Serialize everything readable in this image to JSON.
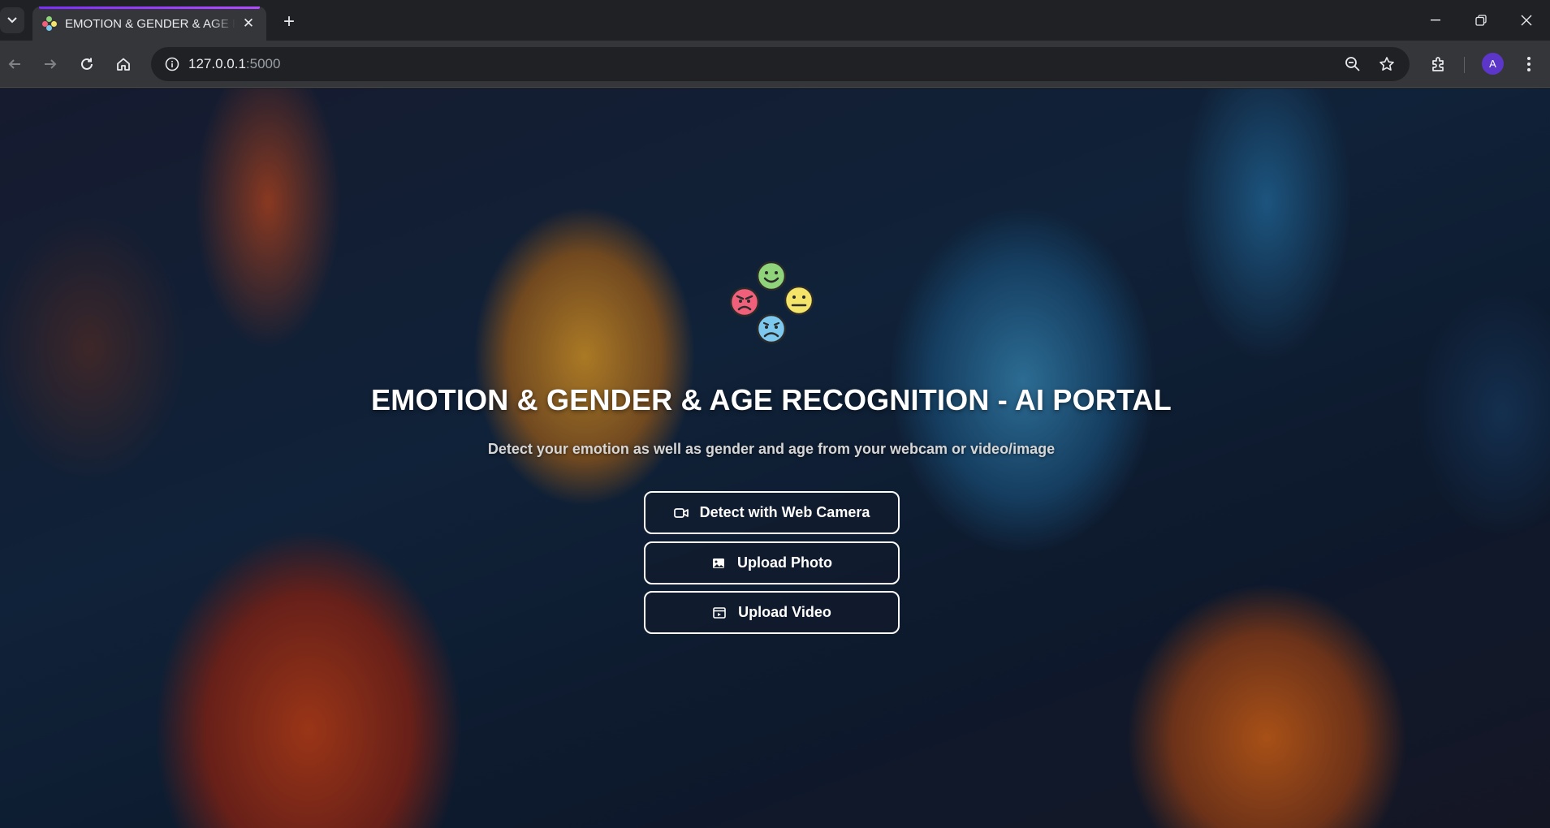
{
  "browser": {
    "tab_title": "EMOTION & GENDER & AGE RECOGNITION - AI PORTAL",
    "url_host": "127.0.0.1",
    "url_port": ":5000",
    "profile_initial": "A"
  },
  "hero": {
    "title": "EMOTION & GENDER & AGE RECOGNITION - AI PORTAL",
    "subtitle": "Detect your emotion as well as gender and age from your webcam or video/image"
  },
  "actions": {
    "webcam_label": "Detect with Web Camera",
    "photo_label": "Upload Photo",
    "video_label": "Upload Video"
  },
  "icons": {
    "webcam": "video-camera-icon",
    "photo": "image-icon",
    "video": "video-file-icon"
  },
  "colors": {
    "button_border": "#ffffff",
    "tab_accent": "#7b2ff7",
    "emoji_happy": "#8fd47a",
    "emoji_angry": "#f0607a",
    "emoji_neutral": "#f5e46a",
    "emoji_sad": "#7cc8ee"
  }
}
